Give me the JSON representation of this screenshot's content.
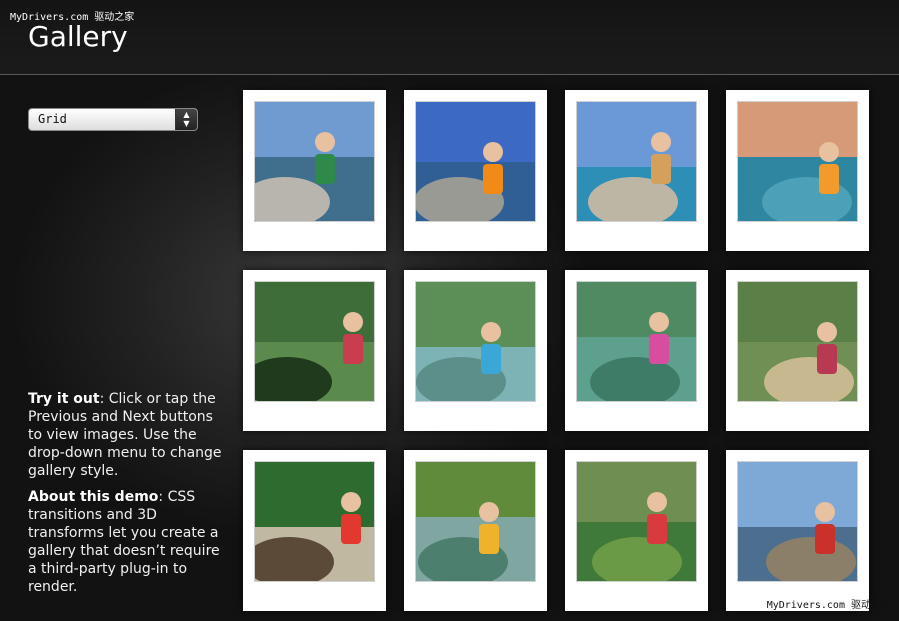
{
  "watermark": {
    "top": "MyDrivers.com 驱动之家",
    "bottom": "MyDrivers.com 驱动之家"
  },
  "header": {
    "title": "Gallery"
  },
  "style_select": {
    "value": "Grid",
    "arrows_icon": "up-down-arrows-icon"
  },
  "info": {
    "try_title": "Try it out",
    "try_text": ": Click or tap the Previous and Next buttons to view images. Use the drop-down menu to change gallery style.",
    "about_title": "About this demo",
    "about_text": ": CSS transitions and 3D transforms let you create a gallery that doesn’t require a third-party plug-in to render."
  },
  "photos": [
    {
      "sky": "#6f9bd0",
      "ground": "#b7b5ad",
      "water": "#3f6f8c",
      "accent": "#2e8a4a"
    },
    {
      "sky": "#3b69c4",
      "ground": "#9a9a95",
      "water": "#305f96",
      "accent": "#f28a18"
    },
    {
      "sky": "#6b99d8",
      "ground": "#bdb6a5",
      "water": "#2d8fb5",
      "accent": "#d4a15c"
    },
    {
      "sky": "#d79a78",
      "ground": "#4ca0b7",
      "water": "#2e86a0",
      "accent": "#f39a2c"
    },
    {
      "sky": "#3e6d3a",
      "ground": "#1f3a1d",
      "water": "#5b8a4d",
      "accent": "#c93d4f"
    },
    {
      "sky": "#5c8f57",
      "ground": "#5d8f8a",
      "water": "#7eb3b5",
      "accent": "#3aa7d6"
    },
    {
      "sky": "#4f8a62",
      "ground": "#3f7c68",
      "water": "#5da08d",
      "accent": "#d94da0"
    },
    {
      "sky": "#5a7f47",
      "ground": "#c7b890",
      "water": "#6f8f54",
      "accent": "#b73a52"
    },
    {
      "sky": "#2e6b2e",
      "ground": "#5b4a38",
      "water": "#c0b8a0",
      "accent": "#e3382f"
    },
    {
      "sky": "#5f8b3a",
      "ground": "#4d7f6e",
      "water": "#7fa6a0",
      "accent": "#f0b22a"
    },
    {
      "sky": "#6f8f52",
      "ground": "#6a9a45",
      "water": "#3f7a3a",
      "accent": "#d93a40"
    },
    {
      "sky": "#7ea8d6",
      "ground": "#8b7f6a",
      "water": "#4c6f8f",
      "accent": "#c8322b"
    }
  ]
}
